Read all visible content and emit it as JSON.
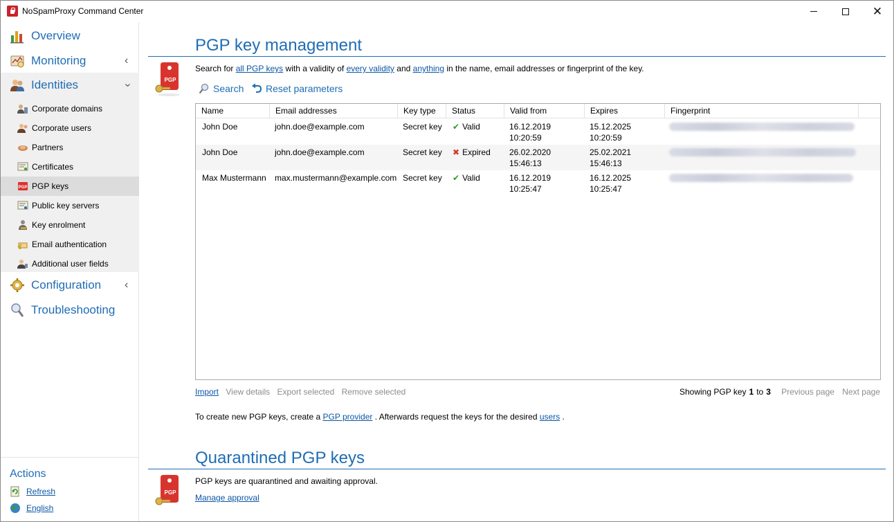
{
  "window": {
    "title": "NoSpamProxy Command Center"
  },
  "sidebar": {
    "top_items": [
      {
        "label": "Overview",
        "icon": "chart-icon"
      },
      {
        "label": "Monitoring",
        "icon": "monitor-icon"
      },
      {
        "label": "Identities",
        "icon": "users-icon"
      }
    ],
    "identities_items": [
      {
        "label": "Corporate domains",
        "icon": "domain-icon"
      },
      {
        "label": "Corporate users",
        "icon": "user-icon"
      },
      {
        "label": "Partners",
        "icon": "partners-icon"
      },
      {
        "label": "Certificates",
        "icon": "certificate-icon"
      },
      {
        "label": "PGP keys",
        "icon": "pgp-icon"
      },
      {
        "label": "Public key servers",
        "icon": "server-icon"
      },
      {
        "label": "Key enrolment",
        "icon": "key-enrolment-icon"
      },
      {
        "label": "Email authentication",
        "icon": "email-auth-icon"
      },
      {
        "label": "Additional user fields",
        "icon": "user-fields-icon"
      }
    ],
    "bottom_items": [
      {
        "label": "Configuration",
        "icon": "gear-icon"
      },
      {
        "label": "Troubleshooting",
        "icon": "search-icon"
      }
    ],
    "selected": "PGP keys"
  },
  "actions": {
    "title": "Actions",
    "items": [
      {
        "label": "Refresh",
        "icon": "refresh-icon"
      },
      {
        "label": "English",
        "icon": "globe-icon"
      }
    ]
  },
  "pgp_section": {
    "title": "PGP key management",
    "search_prefix": "Search for",
    "search_all": "all PGP keys",
    "search_mid1": "with a validity of",
    "search_validity": "every validity",
    "search_mid2": "and",
    "search_anything": "anything",
    "search_suffix": "in the name, email addresses or fingerprint of the key.",
    "search_button": "Search",
    "reset_button": "Reset parameters",
    "columns": [
      "Name",
      "Email addresses",
      "Key type",
      "Status",
      "Valid from",
      "Expires",
      "Fingerprint"
    ],
    "rows": [
      {
        "name": "John Doe",
        "email": "john.doe@example.com",
        "key_type": "Secret key",
        "status": "Valid",
        "valid_from_date": "16.12.2019",
        "valid_from_time": "10:20:59",
        "expires_date": "15.12.2025",
        "expires_time": "10:20:59"
      },
      {
        "name": "John Doe",
        "email": "john.doe@example.com",
        "key_type": "Secret key",
        "status": "Expired",
        "valid_from_date": "26.02.2020",
        "valid_from_time": "15:46:13",
        "expires_date": "25.02.2021",
        "expires_time": "15:46:13"
      },
      {
        "name": "Max Mustermann",
        "email": "max.mustermann@example.com",
        "key_type": "Secret key",
        "status": "Valid",
        "valid_from_date": "16.12.2019",
        "valid_from_time": "10:25:47",
        "expires_date": "16.12.2025",
        "expires_time": "10:25:47"
      }
    ],
    "actions": {
      "import": "Import",
      "view_details": "View details",
      "export_selected": "Export selected",
      "remove_selected": "Remove selected"
    },
    "paging": {
      "prefix": "Showing PGP key",
      "from": "1",
      "to_word": "to",
      "to": "3",
      "previous": "Previous page",
      "next": "Next page"
    },
    "note_prefix": "To create new PGP keys, create a",
    "note_link1": "PGP provider",
    "note_mid": ". Afterwards request the keys for the desired",
    "note_link2": "users",
    "note_suffix": "."
  },
  "quarantine_section": {
    "title": "Quarantined PGP keys",
    "description": "PGP keys are quarantined and awaiting approval.",
    "manage_link": "Manage approval"
  },
  "colors": {
    "accent": "#1f6db5",
    "link": "#0b57a4",
    "valid": "#2a9d2a",
    "expired": "#d43c2c",
    "selected_bg": "#dcdcdc",
    "group_bg": "#f0f0f0"
  }
}
